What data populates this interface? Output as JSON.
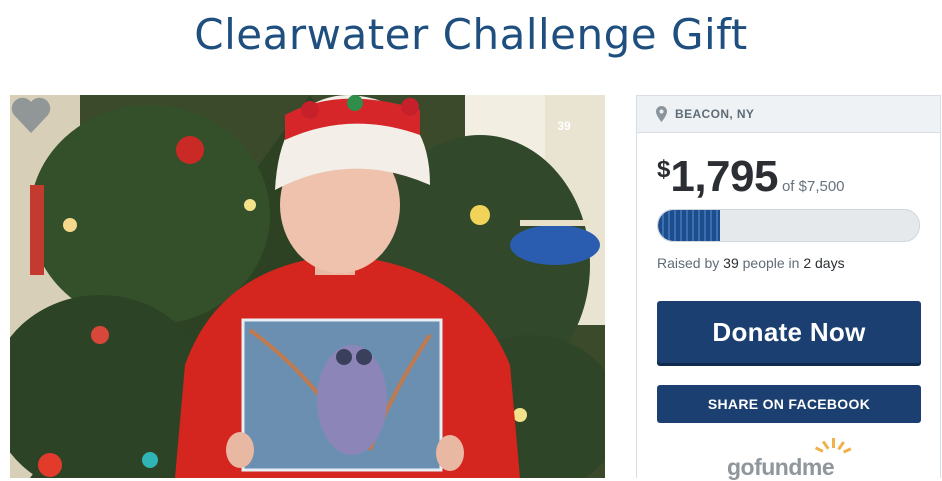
{
  "page": {
    "title": "Clearwater Challenge Gift"
  },
  "photo": {
    "heart_count": "39"
  },
  "campaign": {
    "location": "BEACON, NY",
    "currency_symbol": "$",
    "raised": "1,795",
    "goal_text": "of $7,500",
    "progress_fraction": 0.2393,
    "raised_prefix": "Raised by ",
    "donor_count": "39",
    "people_text": " people in ",
    "days_text": "2 days",
    "donate_label": "Donate Now",
    "share_label": "SHARE ON FACEBOOK",
    "logo_text": "gofundme"
  },
  "colors": {
    "title": "#1f4f7f",
    "button": "#1b3f70",
    "logo_sun": "#f0b04a"
  }
}
